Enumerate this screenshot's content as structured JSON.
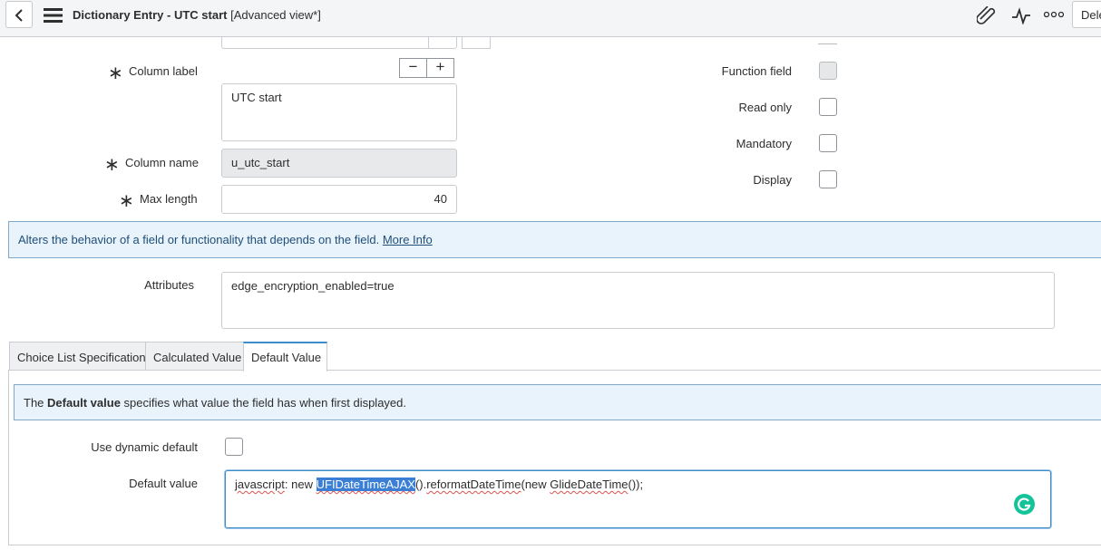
{
  "header": {
    "title_main": "Dictionary Entry - UTC start",
    "title_sub": " [Advanced view*]",
    "delete_label": "Dele",
    "icons": [
      "back-icon",
      "hamburger-menu-icon",
      "paperclip-icon",
      "activity-icon",
      "more-options-icon"
    ]
  },
  "form": {
    "column_label": {
      "label": "Column label",
      "value": "UTC start"
    },
    "column_name": {
      "label": "Column name",
      "value": "u_utc_start"
    },
    "max_length": {
      "label": "Max length",
      "value": "40"
    },
    "function_field": {
      "label": "Function field"
    },
    "read_only": {
      "label": "Read only"
    },
    "mandatory": {
      "label": "Mandatory"
    },
    "display": {
      "label": "Display"
    },
    "minus": "−",
    "plus": "+",
    "required_marker": "∗"
  },
  "info": {
    "text": "Alters the behavior of a field or functionality that depends on the field.",
    "link": "More Info"
  },
  "attributes": {
    "label": "Attributes",
    "value": "edge_encryption_enabled=true"
  },
  "tabs": [
    {
      "label": "Choice List Specification"
    },
    {
      "label": "Calculated Value"
    },
    {
      "label": "Default Value",
      "active": true
    }
  ],
  "default_tab": {
    "info_prefix": "The ",
    "info_bold": "Default value",
    "info_suffix": " specifies what value the field has when first displayed.",
    "use_dynamic_label": "Use dynamic default",
    "default_value_label": "Default value",
    "code": {
      "w1": "javascript",
      "w2": ": new ",
      "w3": "UFIDateTimeAJAX",
      "w4": "().",
      "w5": "reformatDateTime",
      "w6": "(new ",
      "w7": "GlideDateTime",
      "w8": "());"
    }
  },
  "colors": {
    "accent": "#3c8dca",
    "info_bg": "#e9f3fb",
    "grammarly": "#15c39a"
  }
}
